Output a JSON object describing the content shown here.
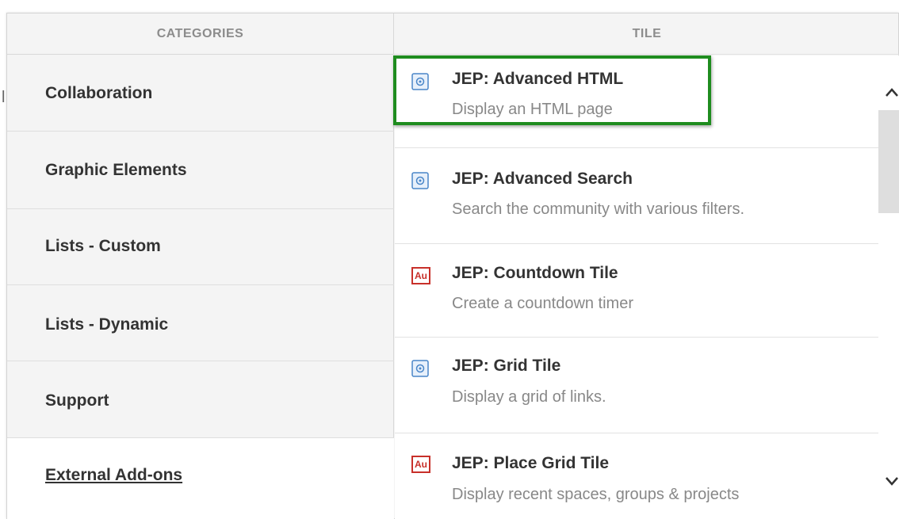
{
  "columns": {
    "categories": "CATEGORIES",
    "tile": "TILE"
  },
  "stray_char": "l",
  "categories": [
    {
      "label": "Collaboration"
    },
    {
      "label": "Graphic Elements"
    },
    {
      "label": "Lists - Custom"
    },
    {
      "label": "Lists - Dynamic"
    },
    {
      "label": "Support"
    },
    {
      "label": "External Add-ons",
      "selected": true
    }
  ],
  "tiles": [
    {
      "title": "JEP: Advanced HTML",
      "description": "Display an HTML page",
      "icon": "app-tile-icon",
      "highlighted": true
    },
    {
      "title": "JEP: Advanced Search",
      "description": "Search the community with various filters.",
      "icon": "app-tile-icon"
    },
    {
      "title": "JEP: Countdown Tile",
      "description": "Create a countdown timer",
      "icon": "adobe-au-icon",
      "icon_text": "Au"
    },
    {
      "title": "JEP: Grid Tile",
      "description": "Display a grid of links.",
      "icon": "app-tile-icon"
    },
    {
      "title": "JEP: Place Grid Tile",
      "description": "Display recent spaces, groups & projects",
      "icon": "adobe-au-icon",
      "icon_text": "Au"
    }
  ],
  "colors": {
    "highlight": "#1e8c1e",
    "adobe_red": "#c8302a",
    "app_blue": "#4a86c8"
  }
}
